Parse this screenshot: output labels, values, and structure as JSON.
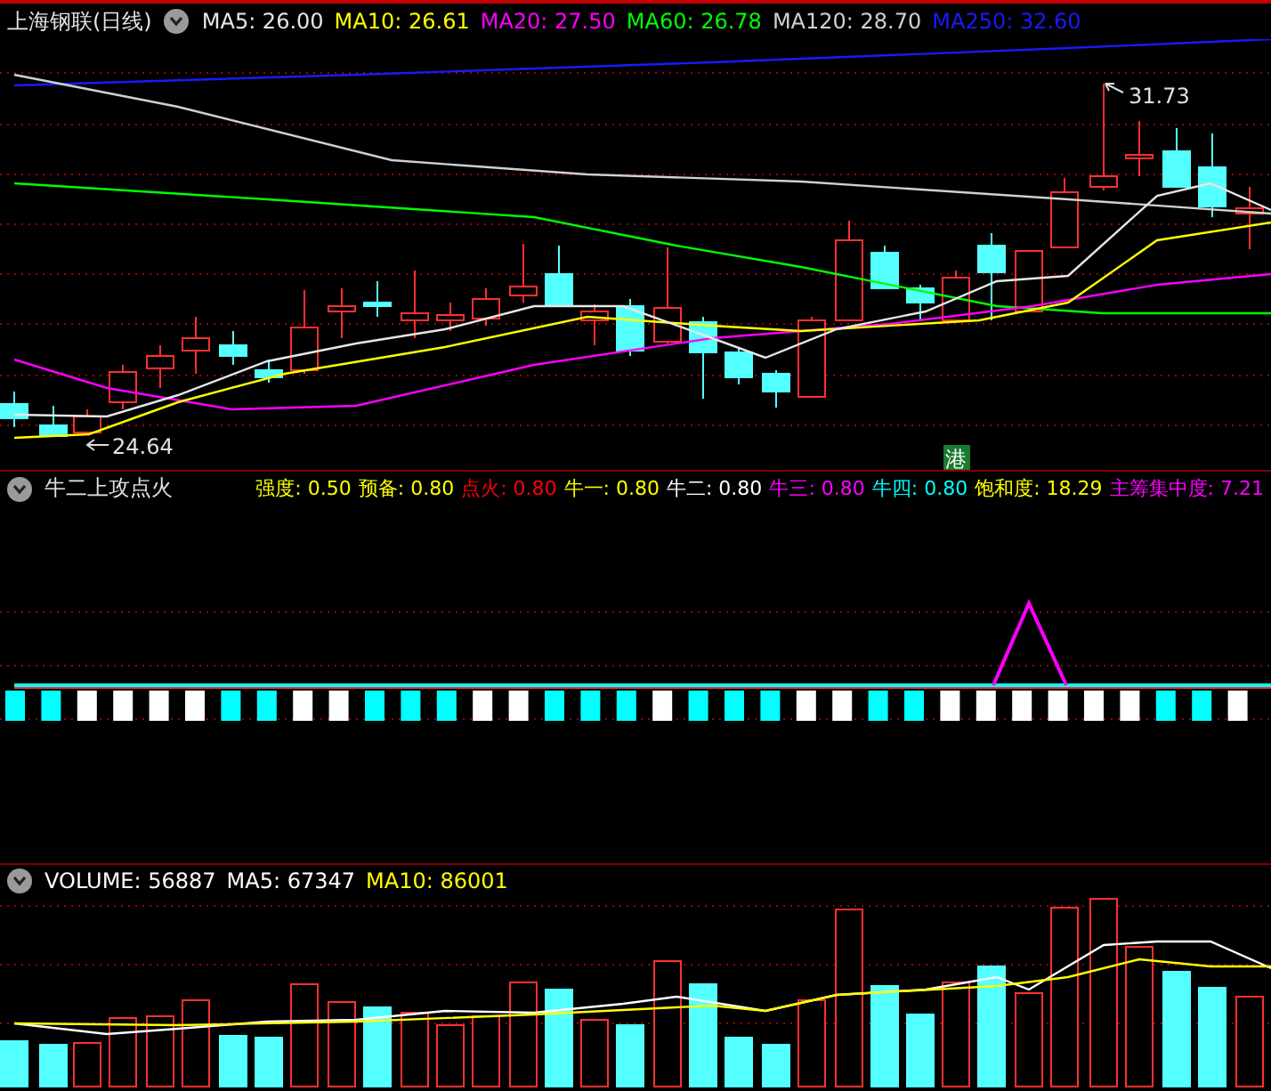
{
  "main_panel": {
    "title": "上海钢联(日线)",
    "legend": [
      {
        "text": "MA5: 26.00",
        "color": "#e6e6e6"
      },
      {
        "text": "MA10: 26.61",
        "color": "#ffff00"
      },
      {
        "text": "MA20: 27.50",
        "color": "#ff00ff"
      },
      {
        "text": "MA60: 26.78",
        "color": "#00ff00"
      },
      {
        "text": "MA120: 28.70",
        "color": "#d0d0d0"
      },
      {
        "text": "MA250: 32.60",
        "color": "#1a1aff"
      }
    ],
    "high_label": "31.73",
    "low_label": "24.64",
    "badge": "港"
  },
  "indicator_panel": {
    "title": "牛二上攻点火",
    "legend": [
      {
        "text": "强度: 0.50",
        "color": "#ffff00"
      },
      {
        "text": "预备: 0.80",
        "color": "#ffff00"
      },
      {
        "text": "点火: 0.80",
        "color": "#ff0000"
      },
      {
        "text": "牛一: 0.80",
        "color": "#ffff00"
      },
      {
        "text": "牛二: 0.80",
        "color": "#ffffff"
      },
      {
        "text": "牛三: 0.80",
        "color": "#ff00ff"
      },
      {
        "text": "牛四: 0.80",
        "color": "#00ffff"
      },
      {
        "text": "饱和度: 18.29",
        "color": "#ffff00"
      },
      {
        "text": "主筹集中度: 7.21",
        "color": "#ff00ff"
      }
    ]
  },
  "volume_panel": {
    "legend": [
      {
        "text": "VOLUME: 56887",
        "color": "#ffffff"
      },
      {
        "text": "MA5: 67347",
        "color": "#ffffff"
      },
      {
        "text": "MA10: 86001",
        "color": "#ffff00"
      }
    ]
  }
}
